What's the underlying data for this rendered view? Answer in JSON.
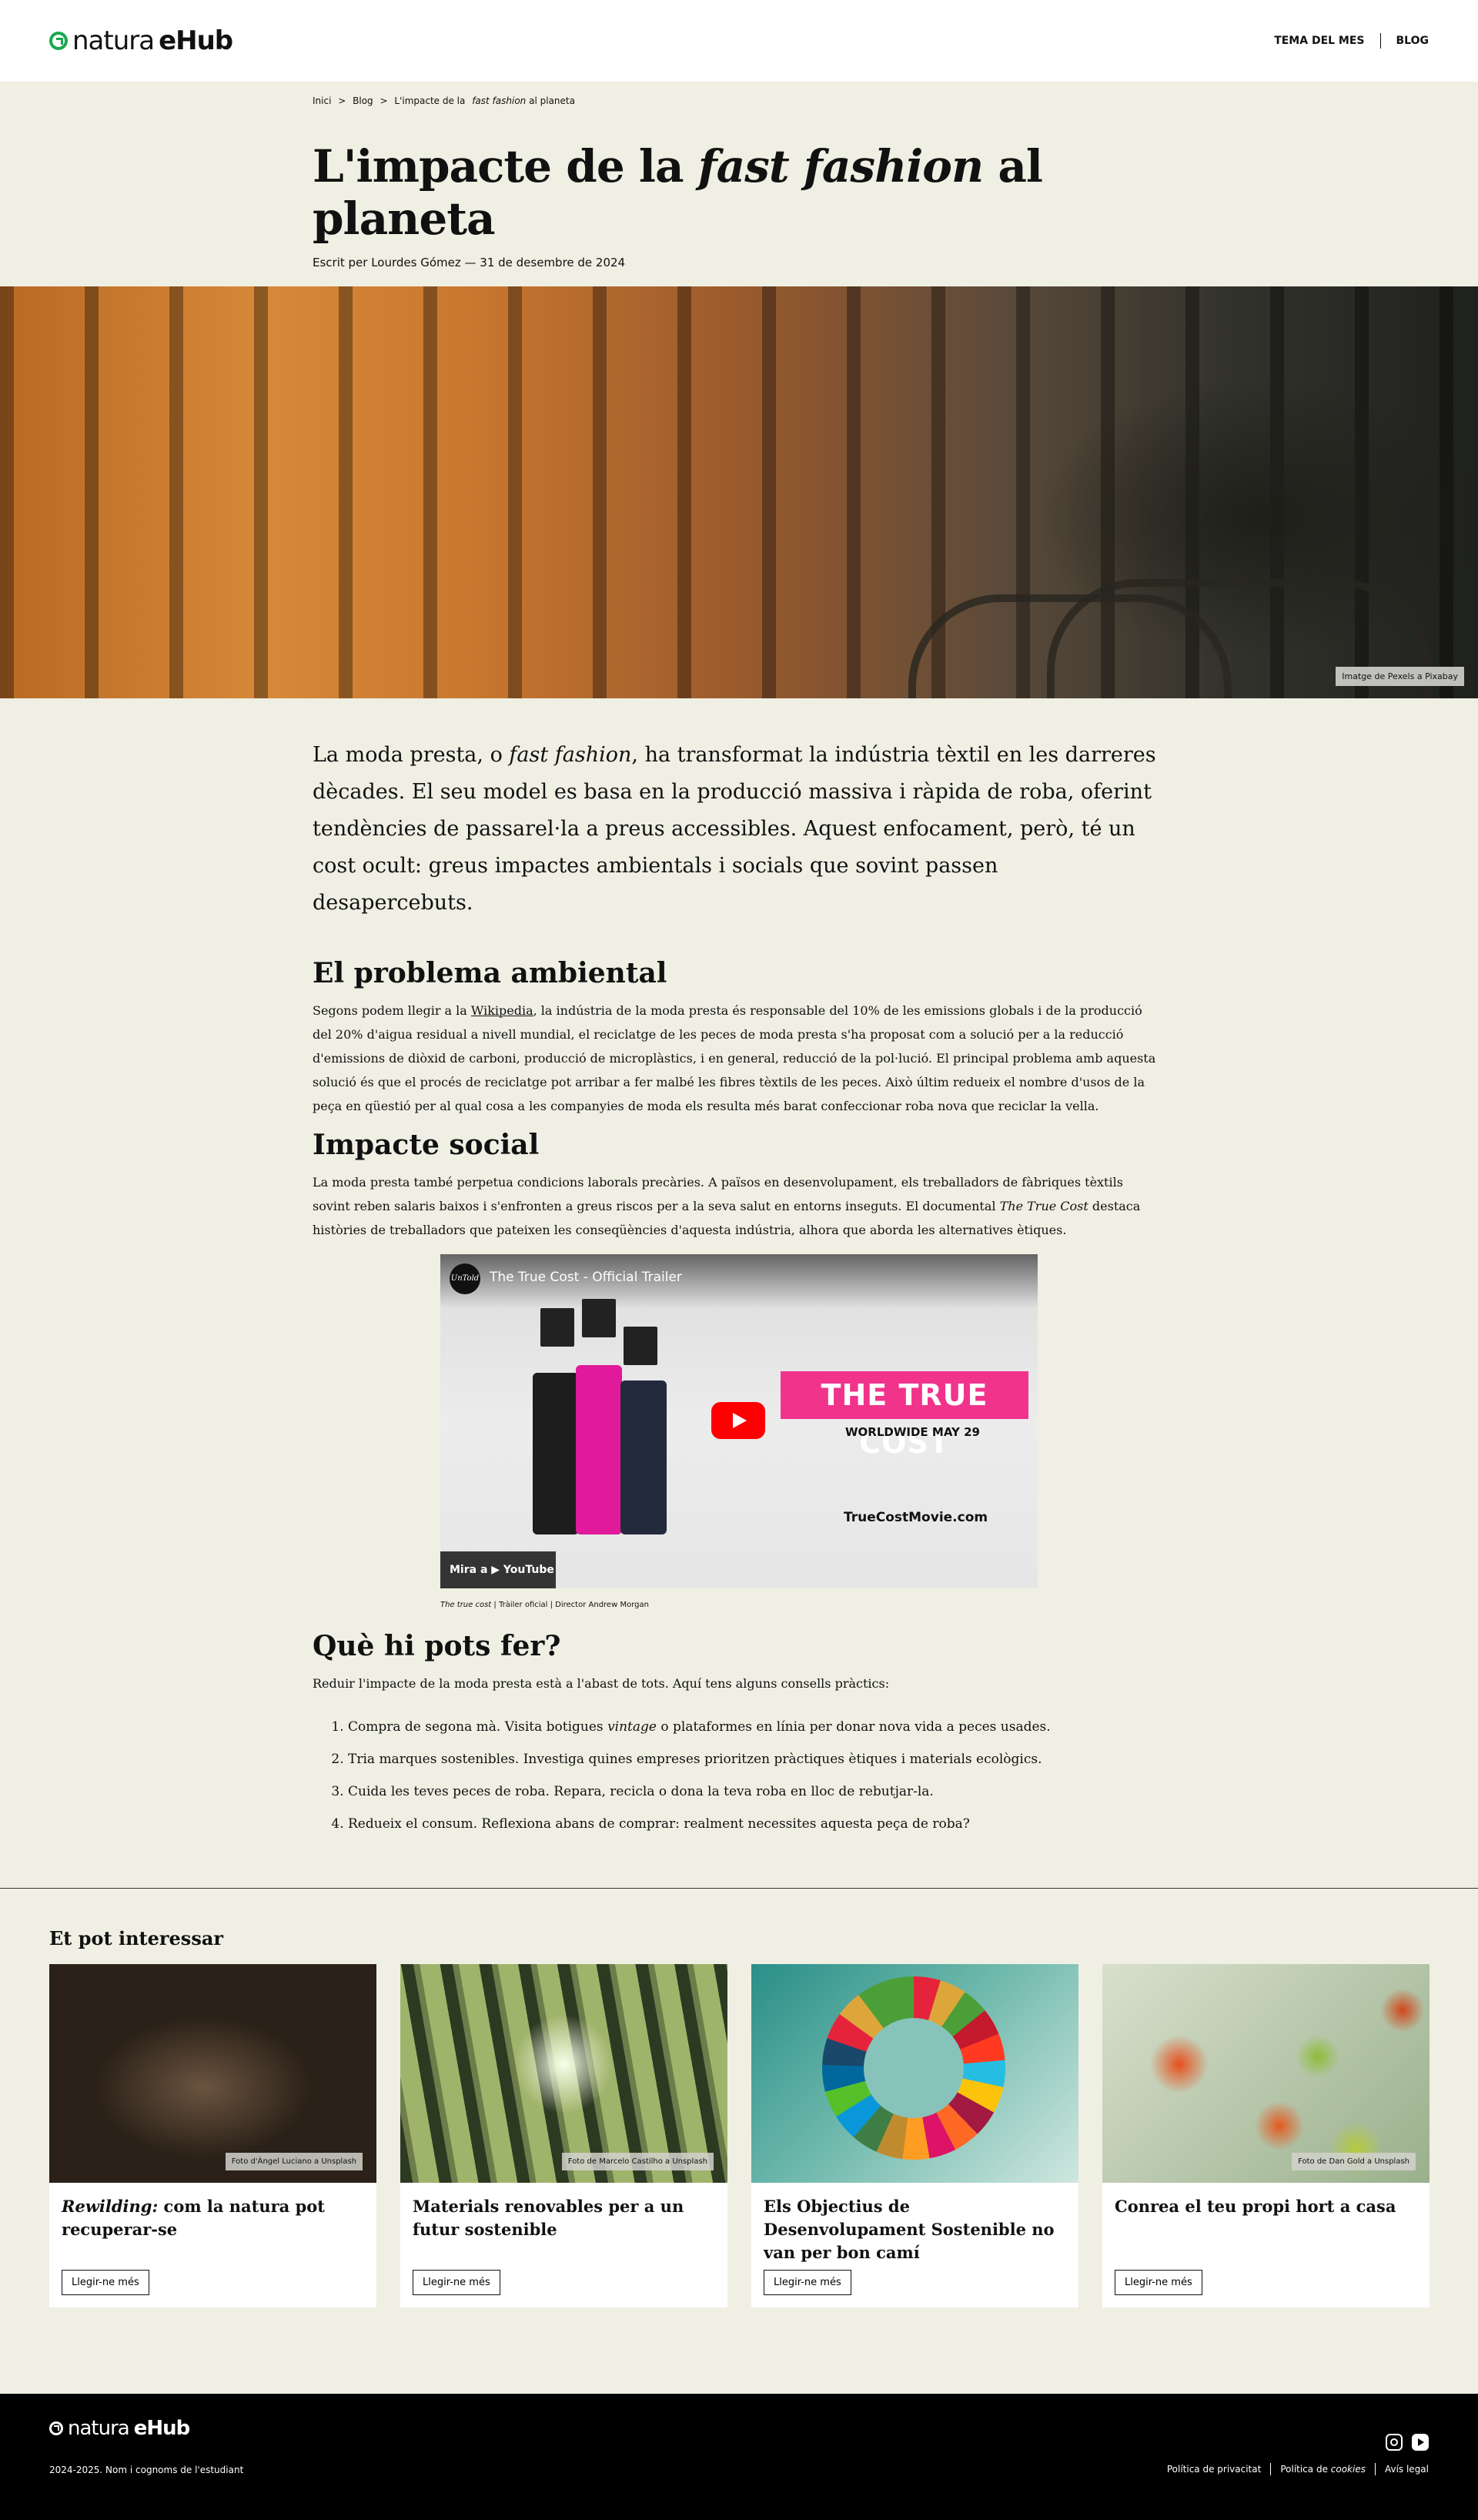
{
  "header": {
    "logo_light": "natura",
    "logo_bold": "eHub",
    "nav": [
      "TEMA DEL MES",
      "BLOG"
    ]
  },
  "breadcrumb": [
    "Inici",
    ">",
    "Blog",
    ">",
    "L'impacte de la",
    "fast fashion",
    "al planeta"
  ],
  "article": {
    "title_a": "L'impacte de la ",
    "title_em": "fast fashion",
    "title_b": " al planeta",
    "byline": "Escrit per Lourdes Gómez — 31 de desembre de 2024",
    "hero_credit": "Imatge de Pexels a Pixabay",
    "lead_a": "La moda presta, o ",
    "lead_em": "fast fashion",
    "lead_b": ", ha transformat la indústria tèxtil en les darreres dècades. El seu model es basa en la producció massiva i ràpida de roba, oferint tendències de passarel·la a preus accessibles. Aquest enfocament, però, té un cost ocult: greus impactes ambientals i socials que sovint passen desapercebuts.",
    "h2_env": "El problema ambiental",
    "env_a": "Segons podem llegir a la ",
    "env_link": "Wikipedia",
    "env_b": ", la indústria de la moda presta és responsable del 10% de les emissions globals i de la producció del 20% d'aigua residual a nivell mundial, el reciclatge de les peces de moda presta s'ha proposat com a solució per a la reducció d'emissions de diòxid de carboni, producció de microplàstics, i en general, reducció de la pol·lució. El principal problema amb aquesta solució és que el procés de reciclatge pot arribar a fer malbé les fibres tèxtils de les peces. Això últim redueix el nombre d'usos de la peça en qüestió per al qual cosa a les companyies de moda els resulta més barat confeccionar roba nova que reciclar la vella.",
    "h2_soc": "Impacte social",
    "soc_a": "La moda presta també perpetua condicions laborals precàries. A països en desenvolupament, els treballadors de fàbriques tèxtils sovint reben salaris baixos i s'enfronten a greus riscos per a la seva salut en entorns inseguts. El documental ",
    "soc_em": "The True Cost",
    "soc_b": " destaca històries de treballadors que pateixen les conseqüències d'aquesta indústria, alhora que aborda les alternatives ètiques.",
    "video": {
      "channel": "UnTold",
      "title": "The True Cost - Official Trailer",
      "brand": "THE TRUE COST",
      "date": "WORLDWIDE MAY 29",
      "site": "TrueCostMovie.com",
      "watch": "Mira a ▶ YouTube"
    },
    "video_cap_em": "The true cost",
    "video_cap_b": " | Tràiler oficial | Director Andrew Morgan",
    "h2_do": "Què hi pots fer?",
    "do_intro": "Reduir l'impacte de la moda presta està a l'abast de tots. Aquí tens alguns consells pràctics:",
    "tips": [
      {
        "a": "Compra de segona mà. Visita botigues ",
        "em": "vintage",
        "b": " o plataformes en línia per donar nova vida a peces usades."
      },
      {
        "a": "Tria marques sostenibles. Investiga quines empreses prioritzen pràctiques ètiques i materials ecològics.",
        "em": "",
        "b": ""
      },
      {
        "a": "Cuida les teves peces de roba. Repara, recicla o dona la teva roba en lloc de rebutjar-la.",
        "em": "",
        "b": ""
      },
      {
        "a": "Redueix el consum. Reflexiona abans de comprar: realment necessites aquesta peça de roba?",
        "em": "",
        "b": ""
      }
    ]
  },
  "related": {
    "heading": "Et pot interessar",
    "cards": [
      {
        "em": "Rewilding:",
        "title": " com la natura pot recuperar-se",
        "credit": "Foto d'Àngel Luciano a Unsplash",
        "button": "Llegir-ne més"
      },
      {
        "em": "",
        "title": "Materials renovables per a un futur sostenible",
        "credit": "Foto de Marcelo Castilho a Unsplash",
        "button": "Llegir-ne més"
      },
      {
        "em": "",
        "title": "Els Objectius de Desenvolupament Sostenible no van per bon camí",
        "credit": "",
        "button": "Llegir-ne més"
      },
      {
        "em": "",
        "title": "Conrea el teu propi hort a casa",
        "credit": "Foto de Dan Gold a Unsplash",
        "button": "Llegir-ne més"
      }
    ]
  },
  "footer": {
    "logo_light": "natura",
    "logo_bold": "eHub",
    "copyright": "2024-2025. Nom i cognoms de l'estudiant",
    "legal": [
      "Política de privacitat",
      "Política de ",
      "cookies",
      "Avís legal"
    ]
  }
}
